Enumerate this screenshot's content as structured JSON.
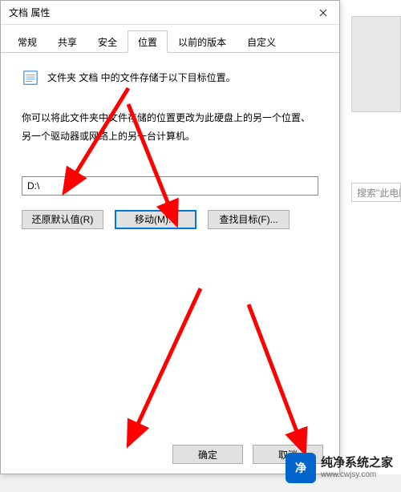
{
  "titlebar": {
    "title": "文档 属性"
  },
  "tabs": {
    "items": [
      {
        "label": "常规"
      },
      {
        "label": "共享"
      },
      {
        "label": "安全"
      },
      {
        "label": "位置"
      },
      {
        "label": "以前的版本"
      },
      {
        "label": "自定义"
      }
    ],
    "active_index": 3
  },
  "content": {
    "info": "文件夹 文档 中的文件存储于以下目标位置。",
    "description": "你可以将此文件夹中文件存储的位置更改为此硬盘上的另一个位置、另一个驱动器或网络上的另一台计算机。",
    "path_value": "D:\\",
    "restore_label": "还原默认值(R)",
    "move_label": "移动(M)...",
    "find_label": "查找目标(F)..."
  },
  "footer": {
    "ok": "确定",
    "cancel": "取消"
  },
  "right": {
    "search_placeholder": "搜索\"此电脑"
  },
  "watermark": {
    "name": "纯净系统之家",
    "url": "www.cwjsy.com"
  }
}
